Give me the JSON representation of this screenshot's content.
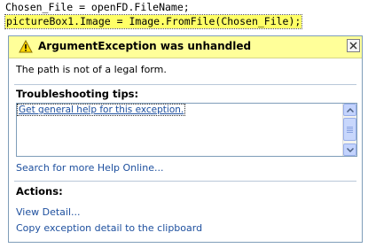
{
  "code": {
    "line1": "Chosen_File = openFD.FileName;",
    "line2": "pictureBox1.Image = Image.FromFile(Chosen_File);"
  },
  "assistant": {
    "title": "ArgumentException was unhandled",
    "message": "The path is not of a legal form.",
    "tips_title": "Troubleshooting tips:",
    "tips": [
      "Get general help for this exception."
    ],
    "search_link": "Search for more Help Online...",
    "actions_title": "Actions:",
    "actions": [
      "View Detail...",
      "Copy exception detail to the clipboard"
    ],
    "icon": "warning-icon",
    "colors": {
      "header_bg": "#ffff99",
      "link": "#1d4f9e",
      "highlight": "#ffff66",
      "border": "#7f9db9"
    }
  }
}
